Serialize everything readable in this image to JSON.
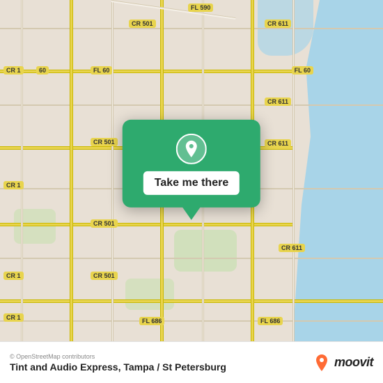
{
  "map": {
    "attribution": "© OpenStreetMap contributors",
    "background_color": "#e8e0d5",
    "water_color": "#a8d4e8",
    "green_color": "#c8e0b0",
    "road_color": "#f5f0e8",
    "road_yellow": "#e8d44d"
  },
  "popup": {
    "background_color": "#2eaa6e",
    "button_label": "Take me there",
    "pin_icon": "location-pin"
  },
  "road_labels": [
    "CR 501",
    "CR 501",
    "CR 501",
    "CR 501",
    "CR 611",
    "CR 611",
    "CR 611",
    "CR 611",
    "CR 1",
    "CR 1",
    "CR 1",
    "CR 1",
    "FL 590",
    "FL 60",
    "FL 60",
    "FL 686",
    "FL 686",
    "60"
  ],
  "bottom_bar": {
    "attribution": "© OpenStreetMap contributors",
    "location_name": "Tint and Audio Express, Tampa / St Petersburg",
    "moovit_text": "moovit"
  }
}
